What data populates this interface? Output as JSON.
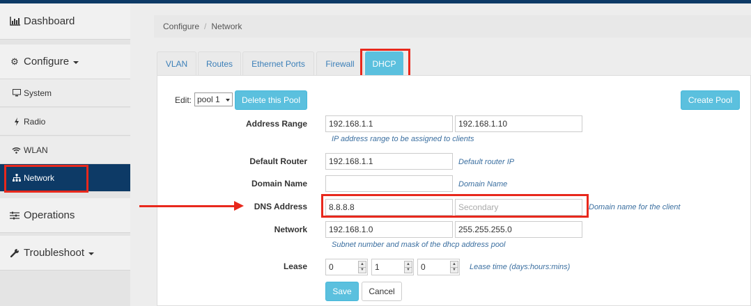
{
  "sidebar": {
    "dashboard": {
      "label": "Dashboard",
      "icon": "bar-chart-icon"
    },
    "configure": {
      "label": "Configure",
      "icon": "gear-icon"
    },
    "items": [
      {
        "label": "System",
        "icon": "monitor-icon"
      },
      {
        "label": "Radio",
        "icon": "bolt-icon"
      },
      {
        "label": "WLAN",
        "icon": "wifi-icon"
      },
      {
        "label": "Network",
        "icon": "sitemap-icon",
        "active": true
      }
    ],
    "operations": {
      "label": "Operations",
      "icon": "sliders-icon"
    },
    "troubleshoot": {
      "label": "Troubleshoot",
      "icon": "wrench-icon"
    }
  },
  "breadcrumb": {
    "items": [
      "Configure",
      "Network"
    ],
    "separator": "/"
  },
  "tabs": [
    {
      "label": "VLAN"
    },
    {
      "label": "Routes"
    },
    {
      "label": "Ethernet Ports"
    },
    {
      "label": "Firewall"
    },
    {
      "label": "DHCP",
      "active": true
    }
  ],
  "form": {
    "edit_label": "Edit:",
    "pool_select": "pool 1",
    "delete_pool": "Delete this Pool",
    "create_pool": "Create Pool",
    "address_range": {
      "label": "Address Range",
      "start": "192.168.1.1",
      "end": "192.168.1.10",
      "help": "IP address range to be assigned to clients"
    },
    "default_router": {
      "label": "Default Router",
      "value": "192.168.1.1",
      "help": "Default router IP"
    },
    "domain_name": {
      "label": "Domain Name",
      "value": "",
      "help": "Domain Name"
    },
    "dns_address": {
      "label": "DNS Address",
      "primary": "8.8.8.8",
      "secondary_placeholder": "Secondary",
      "help": "Domain name for the client"
    },
    "network": {
      "label": "Network",
      "subnet": "192.168.1.0",
      "mask": "255.255.255.0",
      "help": "Subnet number and mask of the dhcp address pool"
    },
    "lease": {
      "label": "Lease",
      "days": "0",
      "hours": "1",
      "mins": "0",
      "help": "Lease time (days:hours:mins)"
    },
    "save": "Save",
    "cancel": "Cancel"
  },
  "colors": {
    "accent": "#5bc0de",
    "nav_active": "#0d3a66",
    "highlight": "#e8281c",
    "help_text": "#3b6fa0"
  }
}
